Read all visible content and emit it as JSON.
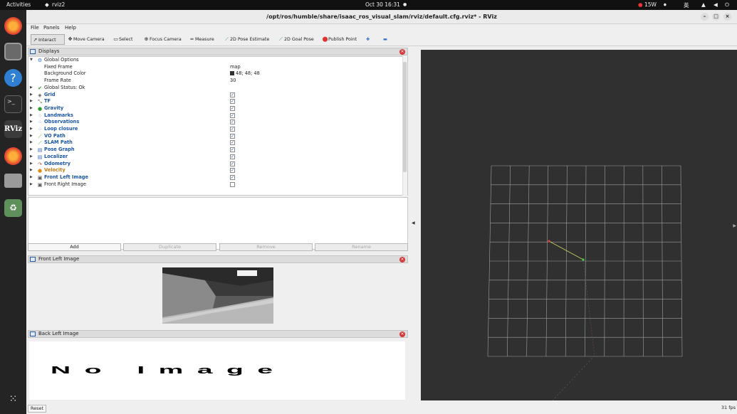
{
  "topbar": {
    "activities": "Activities",
    "app": "rviz2",
    "clock": "Oct 30  16:31",
    "weather": "15W",
    "lang": "英"
  },
  "window": {
    "title": "/opt/ros/humble/share/isaac_ros_visual_slam/rviz/default.cfg.rviz* - RViz"
  },
  "menu": [
    "File",
    "Panels",
    "Help"
  ],
  "toolbar": [
    {
      "label": "Interact",
      "icon": "pointer-icon"
    },
    {
      "label": "Move Camera",
      "icon": "move-camera-icon"
    },
    {
      "label": "Select",
      "icon": "select-icon"
    },
    {
      "label": "Focus Camera",
      "icon": "focus-camera-icon"
    },
    {
      "label": "Measure",
      "icon": "measure-icon"
    },
    {
      "label": "2D Pose Estimate",
      "icon": "pose-estimate-icon"
    },
    {
      "label": "2D Goal Pose",
      "icon": "goal-pose-icon"
    },
    {
      "label": "Publish Point",
      "icon": "publish-point-icon"
    }
  ],
  "displays": {
    "title": "Displays",
    "global_options": {
      "label": "Global Options",
      "fixed_frame_label": "Fixed Frame",
      "fixed_frame": "map",
      "bg_label": "Background Color",
      "bg_value": "48; 48; 48",
      "frame_rate_label": "Frame Rate",
      "frame_rate": "30"
    },
    "global_status": "Global Status: Ok",
    "items": [
      {
        "label": "Grid",
        "icon": "grid-icon",
        "color": "#1a55a6"
      },
      {
        "label": "TF",
        "icon": "tf-icon",
        "color": "#1a55a6"
      },
      {
        "label": "Gravity",
        "icon": "gravity-icon",
        "color": "#1a55a6"
      },
      {
        "label": "Landmarks",
        "icon": "landmarks-icon",
        "color": "#1a55a6"
      },
      {
        "label": "Observations",
        "icon": "observations-icon",
        "color": "#1a55a6"
      },
      {
        "label": "Loop closure",
        "icon": "loop-closure-icon",
        "color": "#1a55a6"
      },
      {
        "label": "VO Path",
        "icon": "path-icon",
        "color": "#1a55a6"
      },
      {
        "label": "SLAM Path",
        "icon": "path-icon",
        "color": "#1a55a6"
      },
      {
        "label": "Pose Graph",
        "icon": "folder-icon",
        "color": "#1a55a6"
      },
      {
        "label": "Localizer",
        "icon": "folder-icon",
        "color": "#1a55a6"
      },
      {
        "label": "Odometry",
        "icon": "odometry-icon",
        "color": "#1a55a6"
      },
      {
        "label": "Velocity",
        "icon": "velocity-icon",
        "color": "#c77a12"
      },
      {
        "label": "Front Left Image",
        "icon": "image-icon",
        "color": "#1a55a6"
      },
      {
        "label": "Front Right Image",
        "icon": "image-icon",
        "color": "#222222"
      }
    ],
    "buttons": {
      "add": "Add",
      "duplicate": "Duplicate",
      "remove": "Remove",
      "rename": "Rename"
    }
  },
  "front_left_panel": {
    "title": "Front Left Image"
  },
  "back_left_panel": {
    "title": "Back Left Image",
    "placeholder": "No Image"
  },
  "status": {
    "reset": "Reset",
    "fps": "31 fps"
  },
  "colors": {
    "viewport_bg": "#303030",
    "grid": "#a0a0a0",
    "path_green": "#3ecf3e",
    "path_red": "#d04040"
  }
}
